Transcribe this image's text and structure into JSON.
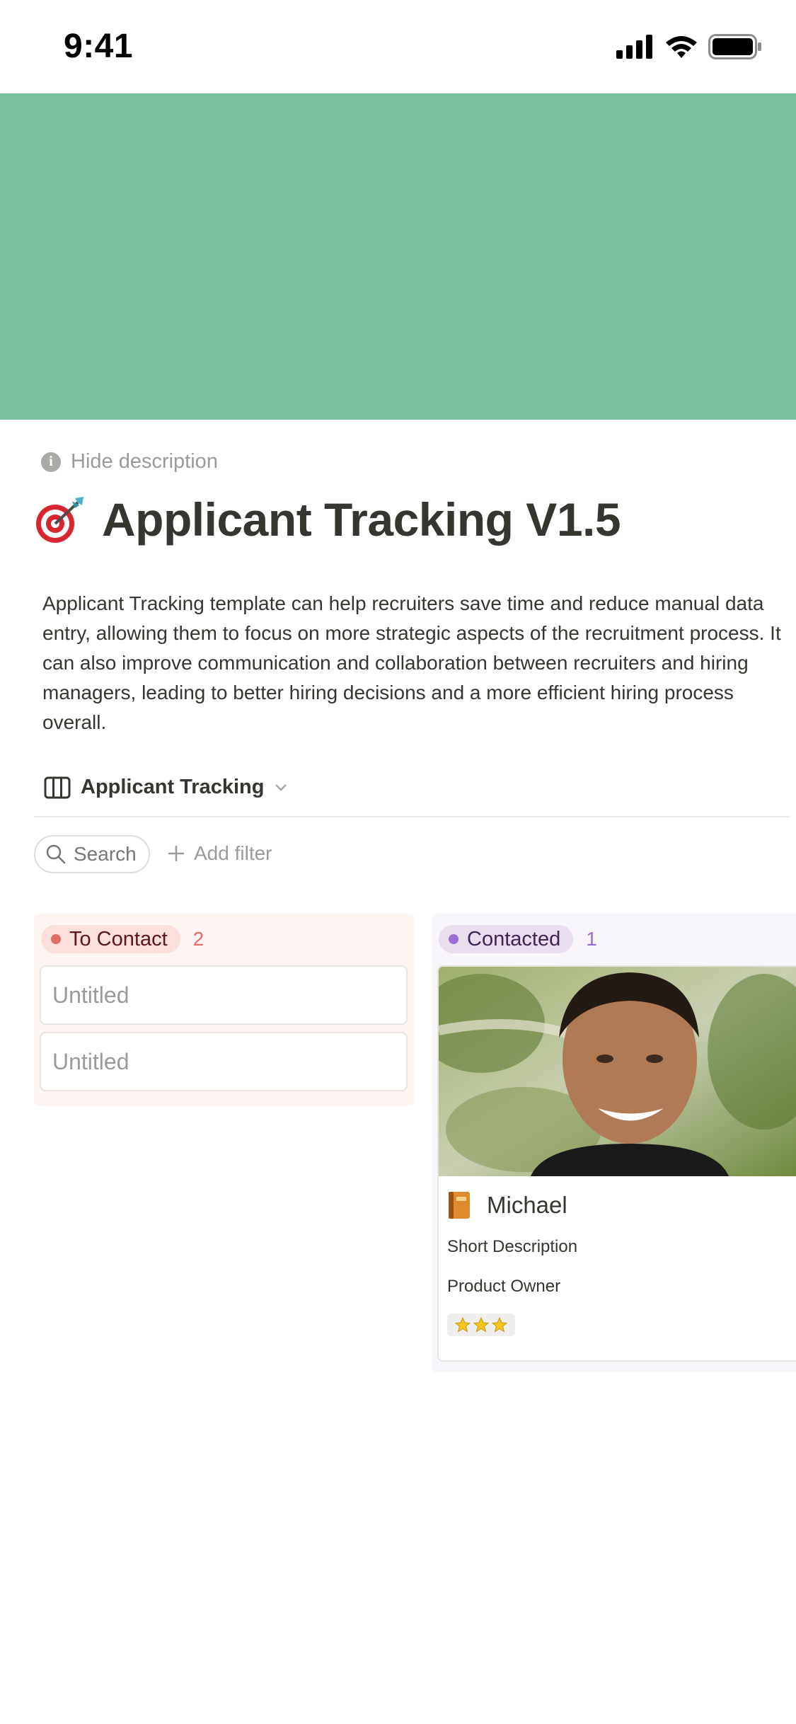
{
  "status_bar": {
    "time": "9:41"
  },
  "page": {
    "hide_description": "Hide description",
    "title": "Applicant Tracking V1.5",
    "description": "Applicant Tracking template can help recruiters save time and reduce manual data entry, allowing them to focus on more strategic aspects of the recruitment process. It can also improve communication and collaboration between recruiters and hiring managers, leading to better hiring decisions and a more efficient hiring process overall."
  },
  "view": {
    "name": "Applicant Tracking"
  },
  "toolbar": {
    "search_label": "Search",
    "add_filter_label": "Add filter"
  },
  "colors": {
    "cover": "#7cc0a2",
    "to_contact": "#e16f64",
    "contacted": "#9a6dd7"
  },
  "board": {
    "columns": [
      {
        "label": "To Contact",
        "count": "2",
        "cards": [
          {
            "title": "Untitled"
          },
          {
            "title": "Untitled"
          }
        ]
      },
      {
        "label": "Contacted",
        "count": "1",
        "cards": [
          {
            "name": "Michael",
            "description": "Short Description",
            "role": "Product Owner",
            "rating": 3
          }
        ]
      }
    ]
  }
}
